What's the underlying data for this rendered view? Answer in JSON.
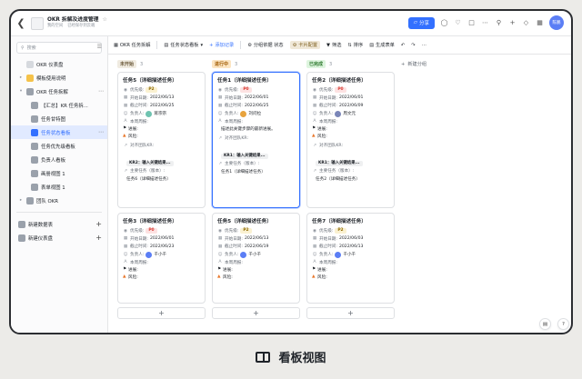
{
  "app": {
    "doc_title": "OKR 拆解及进度管理",
    "location": "我的空间",
    "saved_status": "已经保存到云端",
    "share_label": "分享",
    "avatar_text": "陈鹏"
  },
  "sidebar": {
    "search_placeholder": "搜索",
    "items": [
      {
        "label": "OKR 仪表盘"
      },
      {
        "label": "模板使用说明"
      },
      {
        "label": "OKR 任务拆解"
      },
      {
        "label": "【汇总】KR 任务拆..."
      },
      {
        "label": "任务甘特图"
      },
      {
        "label": "任务状态看板"
      },
      {
        "label": "任务优先级看板"
      },
      {
        "label": "负责人看板"
      },
      {
        "label": "画册视图 1"
      },
      {
        "label": "表单视图 1"
      },
      {
        "label": "团队 OKR"
      }
    ],
    "new_sheet": "新建数据表",
    "new_dashboard": "新建仪表盘"
  },
  "viewbar": {
    "table_name": "OKR 任务拆解",
    "view_name": "任务状态看板",
    "add_record": "添加记录",
    "group_by": "分组依据 状态",
    "card_config": "卡片配置",
    "filter": "筛选",
    "sort": "排序",
    "generate_form": "生成表单"
  },
  "board": {
    "add_group": "新建分组",
    "columns": [
      {
        "status": "未开始",
        "count": "3",
        "pill_bg": "#f0ebe1",
        "pill_fg": "#6b5a3a",
        "cards": [
          {
            "title": "任务5（详细描述任务）",
            "priority": "P2",
            "start": "2022/06/13",
            "end": "2022/06/25",
            "owner": "蒋宗宗",
            "weekly": "本周周报:",
            "progress": "进展:",
            "risk": "风险:"
          },
          {
            "title": "任务3（详细描述任务）",
            "priority": "P0",
            "start": "2022/06/01",
            "end": "2022/06/23",
            "owner": "千小千",
            "weekly": "本周周报:",
            "progress": "进展:",
            "risk": "风险:"
          }
        ],
        "card1_extra": {
          "align_label": "对齐团队KR:",
          "kr": "KR2：输入关键结果...",
          "main_label": "主要任务（版本）:",
          "main_val": "任务6（详细描述任务）"
        }
      },
      {
        "status": "进行中",
        "count": "3",
        "pill_bg": "#fce5c2",
        "pill_fg": "#a05a00",
        "cards": [
          {
            "title": "任务1（详细描述任务）",
            "priority": "P0",
            "start": "2022/06/01",
            "end": "2022/06/25",
            "owner": "刘问拉",
            "weekly": "本周周报:",
            "desc": "描述此关键步骤的最新进展。",
            "align_label": "对齐团队KR:",
            "kr": "KR1：输入关键结果...",
            "main_label": "主要任务（版本）:",
            "main_val": "任务1（详细描述任务）"
          },
          {
            "title": "任务5（详细描述任务）",
            "priority": "P2",
            "start": "2022/06/13",
            "end": "2022/06/19",
            "owner": "千小千",
            "weekly": "本周周报:",
            "progress": "进展:",
            "risk": "风险:"
          }
        ]
      },
      {
        "status": "已完成",
        "count": "3",
        "pill_bg": "#def5df",
        "pill_fg": "#2f7a2f",
        "cards": [
          {
            "title": "任务2（详细描述任务）",
            "priority": "P0",
            "start": "2022/06/01",
            "end": "2022/06/09",
            "owner": "周文元",
            "weekly": "本周周报:",
            "progress": "进展:",
            "risk": "风险:",
            "align_label": "对齐团队KR:",
            "kr": "KR1：输入关键结果...",
            "main_label": "主要任务（版本）:",
            "main_val": "任务2（详细描述任务）"
          },
          {
            "title": "任务7（详细描述任务）",
            "priority": "P2",
            "start": "2022/06/03",
            "end": "2022/06/13",
            "owner": "千小千",
            "weekly": "本周周报:",
            "progress": "进展:",
            "risk": "风险:"
          }
        ]
      }
    ],
    "field_labels": {
      "priority": "优先级:",
      "start": "开始日期:",
      "end": "截止时间:",
      "owner": "负责人:"
    }
  },
  "caption": {
    "text": "看板视图"
  },
  "colors": {
    "accent": "#3370ff",
    "p0": "#d83931",
    "p2": "#8f6a00"
  }
}
